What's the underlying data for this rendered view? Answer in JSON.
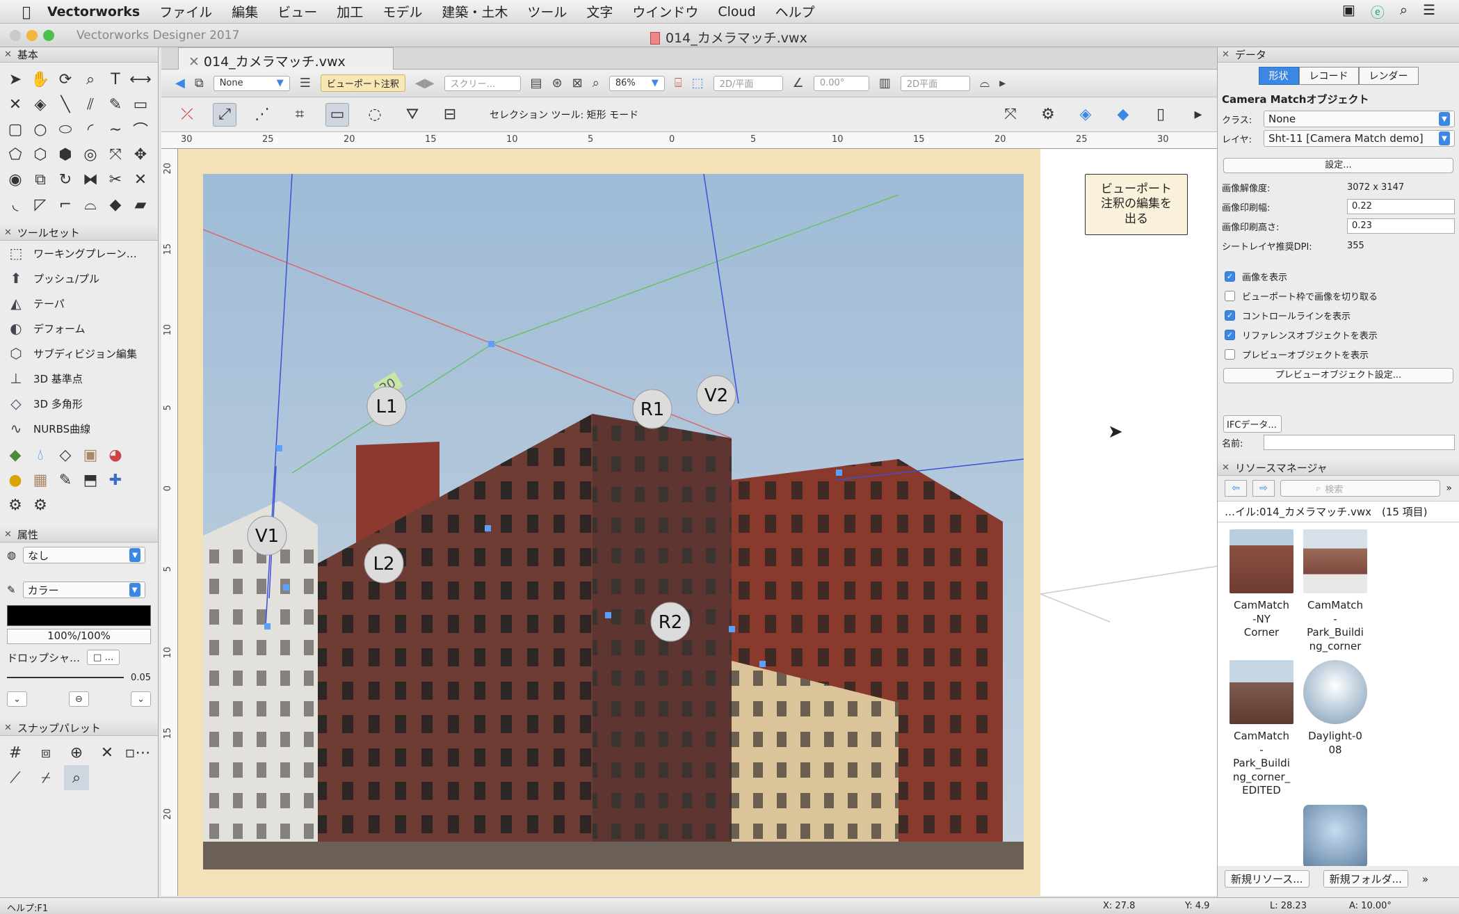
{
  "menubar": {
    "app": "Vectorworks",
    "items": [
      "ファイル",
      "編集",
      "ビュー",
      "加工",
      "モデル",
      "建築・土木",
      "ツール",
      "文字",
      "ウインドウ",
      "Cloud",
      "ヘルプ"
    ]
  },
  "window": {
    "app_version": "Vectorworks Designer 2017",
    "doc_title": "014_カメラマッチ.vwx",
    "tab_label": "014_カメラマッチ.vwx"
  },
  "left": {
    "basic_title": "基本",
    "toolset_title": "ツールセット",
    "toolset_items": [
      {
        "icon": "working-plane-icon",
        "label": "ワーキングプレーン…",
        "glyph": "⬚"
      },
      {
        "icon": "push-pull-icon",
        "label": "プッシュ/プル",
        "glyph": "⬆"
      },
      {
        "icon": "taper-icon",
        "label": "テーパ",
        "glyph": "◭"
      },
      {
        "icon": "deform-icon",
        "label": "デフォーム",
        "glyph": "◐"
      },
      {
        "icon": "subdivision-icon",
        "label": "サブディビジョン編集",
        "glyph": "⬡"
      },
      {
        "icon": "3d-locus-icon",
        "label": "3D 基準点",
        "glyph": "⊥"
      },
      {
        "icon": "3d-polygon-icon",
        "label": "3D 多角形",
        "glyph": "◇"
      },
      {
        "icon": "nurbs-curve-icon",
        "label": "NURBS曲線",
        "glyph": "∿"
      }
    ],
    "attr_title": "属性",
    "fill_value": "なし",
    "pen_value": "カラー",
    "opacity": "100%/100%",
    "drop_shadow": "ドロップシャ…",
    "line_weight": "0.05",
    "snap_title": "スナップパレット"
  },
  "viewbar": {
    "class_sel": "None",
    "viewport_annot": "ビューポート注釈",
    "screen_sel": "スクリー…",
    "zoom": "86%",
    "view_sel": "2D/平面",
    "angle": "0.00°",
    "render_sel": "2D平面"
  },
  "modebar": {
    "mode_text": "セレクション ツール: 矩形 モード"
  },
  "ruler": {
    "h": [
      "30",
      "25",
      "20",
      "15",
      "10",
      "5",
      "0",
      "5",
      "10",
      "15",
      "20",
      "25",
      "30"
    ],
    "v": [
      "20",
      "15",
      "10",
      "5",
      "0",
      "5",
      "10",
      "15",
      "20"
    ]
  },
  "canvas": {
    "markers": [
      "L1",
      "L2",
      "R1",
      "R2",
      "V1",
      "V2"
    ],
    "exit_button": "ビューポート\n注釈の編集を\n出る",
    "angle_tag": "20"
  },
  "right": {
    "data_title": "データ",
    "tabs": [
      "形状",
      "レコード",
      "レンダー"
    ],
    "object_title": "Camera Matchオブジェクト",
    "class_label": "クラス:",
    "class_value": "None",
    "layer_label": "レイヤ:",
    "layer_value": "Sht-11 [Camera Match demo]",
    "settings_button": "設定...",
    "props": [
      {
        "label": "画像解像度:",
        "value": "3072 x 3147",
        "input": false
      },
      {
        "label": "画像印刷幅:",
        "value": "0.22",
        "input": true
      },
      {
        "label": "画像印刷高さ:",
        "value": "0.23",
        "input": true
      },
      {
        "label": "シートレイヤ推奨DPI:",
        "value": "355",
        "input": false
      }
    ],
    "checks": [
      {
        "label": "画像を表示",
        "checked": true
      },
      {
        "label": "ビューポート枠で画像を切り取る",
        "checked": false
      },
      {
        "label": "コントロールラインを表示",
        "checked": true
      },
      {
        "label": "リファレンスオブジェクトを表示",
        "checked": true
      },
      {
        "label": "プレビューオブジェクトを表示",
        "checked": false
      }
    ],
    "preview_button": "プレビューオブジェクト設定...",
    "ifc_button": "IFCデータ...",
    "name_label": "名前:",
    "rm_title": "リソースマネージャ",
    "rm_search": "検索",
    "rm_file": "…イル:014_カメラマッチ.vwx　(15 項目)",
    "resources": [
      {
        "name": "CamMatch\n-NY\nCorner",
        "color": "#8a5040"
      },
      {
        "name": "CamMatch\n-\nPark_Buildi\nng_corner",
        "color": "#9b6a58"
      },
      {
        "name": "CamMatch\n-\nPark_Buildi\nng_corner_\nEDITED",
        "color": "#7e5a50"
      },
      {
        "name": "Daylight-0\n08",
        "color": "#9fb2c2"
      },
      {
        "name": "",
        "color": "#5f7f9f"
      }
    ],
    "new_resource": "新規リソース...",
    "new_folder": "新規フォルダ..."
  },
  "status": {
    "help": "ヘルプ:F1",
    "x": "X: 27.8",
    "y": "Y: 4.9",
    "l": "L: 28.23",
    "a": "A: 10.00°"
  }
}
